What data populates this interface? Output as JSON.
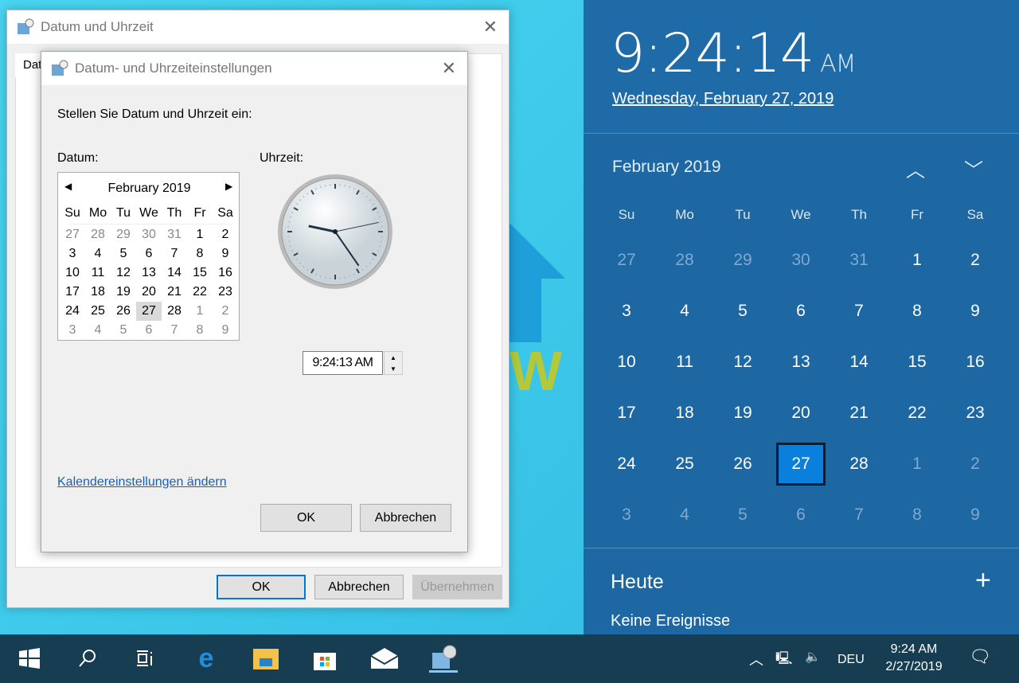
{
  "outer_dialog": {
    "title": "Datum und Uhrzeit",
    "tab": "Dat",
    "ok": "OK",
    "cancel": "Abbrechen",
    "apply": "Übernehmen"
  },
  "inner_dialog": {
    "title": "Datum- und Uhrzeiteinstellungen",
    "instruction": "Stellen Sie Datum und Uhrzeit ein:",
    "date_label": "Datum:",
    "time_label": "Uhrzeit:",
    "calendar": {
      "month": "February 2019",
      "weekdays": [
        "Su",
        "Mo",
        "Tu",
        "We",
        "Th",
        "Fr",
        "Sa"
      ],
      "weeks": [
        [
          "27",
          "28",
          "29",
          "30",
          "31",
          "1",
          "2"
        ],
        [
          "3",
          "4",
          "5",
          "6",
          "7",
          "8",
          "9"
        ],
        [
          "10",
          "11",
          "12",
          "13",
          "14",
          "15",
          "16"
        ],
        [
          "17",
          "18",
          "19",
          "20",
          "21",
          "22",
          "23"
        ],
        [
          "24",
          "25",
          "26",
          "27",
          "28",
          "1",
          "2"
        ],
        [
          "3",
          "4",
          "5",
          "6",
          "7",
          "8",
          "9"
        ]
      ],
      "selected": "27"
    },
    "clock": {
      "hour": 9,
      "minute": 24,
      "second": 13
    },
    "time_value": "9:24:13 AM",
    "calendar_link": "Kalendereinstellungen ändern",
    "ok": "OK",
    "cancel": "Abbrechen"
  },
  "flyout": {
    "time": "9:24:14",
    "ampm": "AM",
    "date": "Wednesday, February 27, 2019",
    "month": "February 2019",
    "weekdays": [
      "Su",
      "Mo",
      "Tu",
      "We",
      "Th",
      "Fr",
      "Sa"
    ],
    "weeks": [
      [
        "27",
        "28",
        "29",
        "30",
        "31",
        "1",
        "2"
      ],
      [
        "3",
        "4",
        "5",
        "6",
        "7",
        "8",
        "9"
      ],
      [
        "10",
        "11",
        "12",
        "13",
        "14",
        "15",
        "16"
      ],
      [
        "17",
        "18",
        "19",
        "20",
        "21",
        "22",
        "23"
      ],
      [
        "24",
        "25",
        "26",
        "27",
        "28",
        "1",
        "2"
      ],
      [
        "3",
        "4",
        "5",
        "6",
        "7",
        "8",
        "9"
      ]
    ],
    "selected": "27",
    "agenda_title": "Heute",
    "agenda_empty": "Keine Ereignisse",
    "colors": {
      "background": "#1d67a3",
      "selected": "#0a7fdc"
    }
  },
  "taskbar": {
    "language": "DEU",
    "time": "9:24 AM",
    "date": "2/27/2019",
    "icons": [
      "windows-start-icon",
      "search-icon",
      "task-view-icon",
      "edge-icon",
      "file-explorer-icon",
      "store-icon",
      "mail-icon",
      "date-time-app-icon"
    ]
  }
}
